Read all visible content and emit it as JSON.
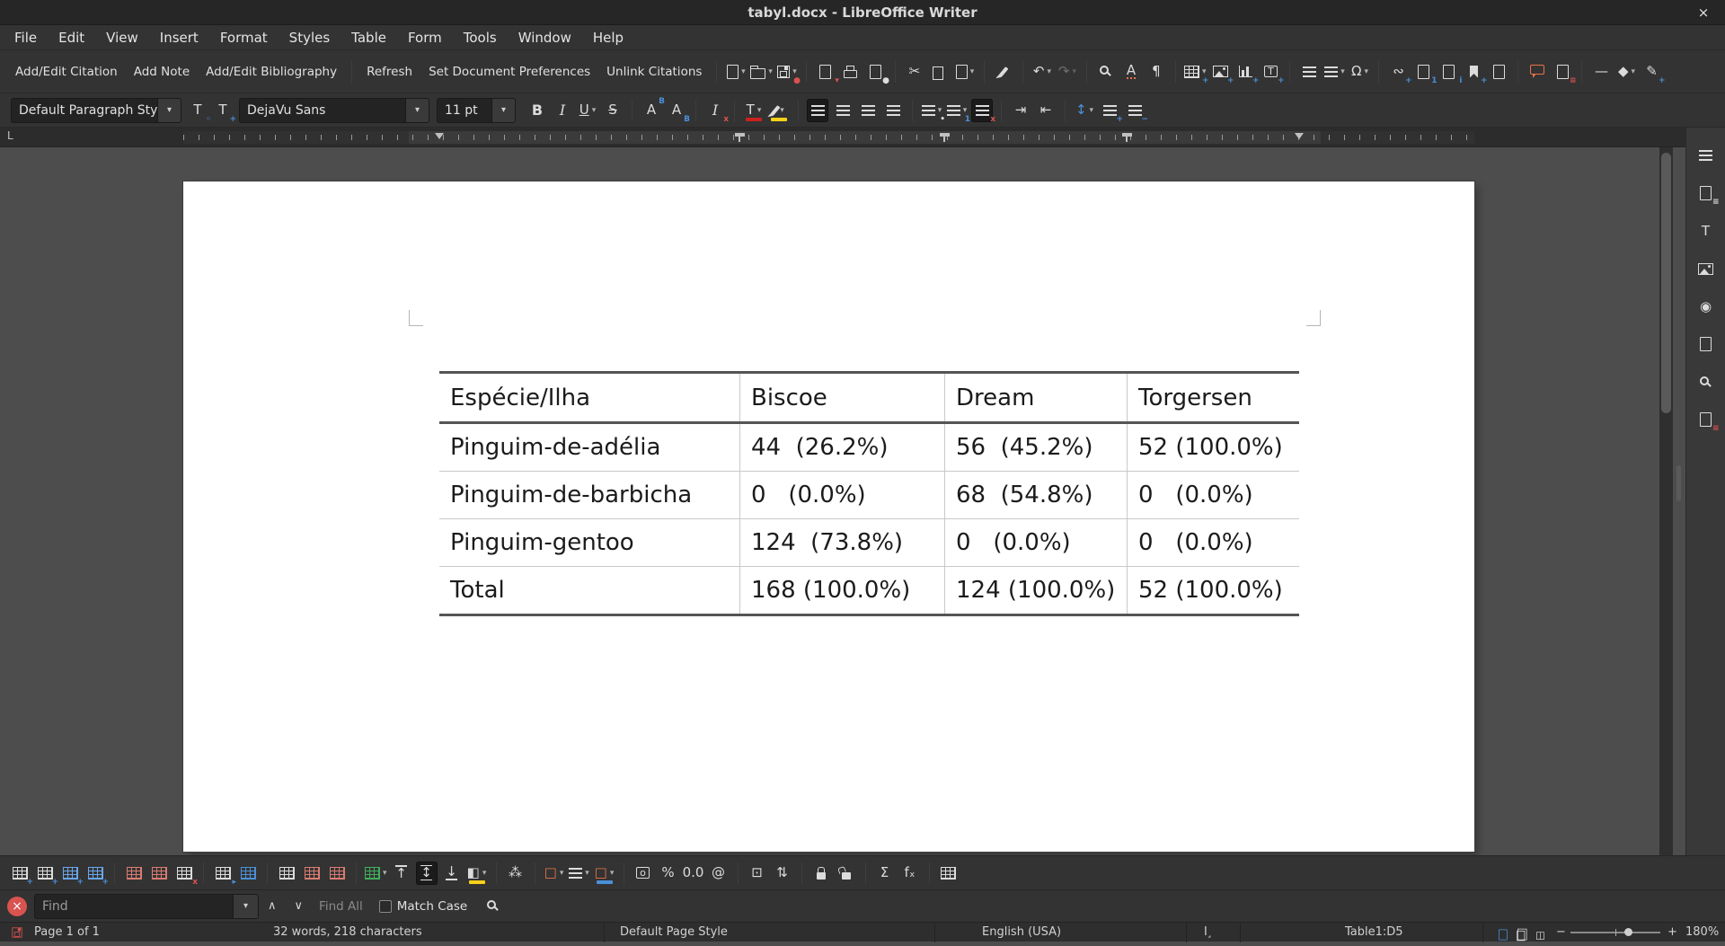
{
  "window": {
    "title": "tabyl.docx - LibreOffice Writer",
    "close_glyph": "×"
  },
  "glyphs": {
    "caret": "▾",
    "minus": "−",
    "plus": "+",
    "tabstop": "L"
  },
  "menubar": {
    "items": [
      "File",
      "Edit",
      "View",
      "Insert",
      "Format",
      "Styles",
      "Table",
      "Form",
      "Tools",
      "Window",
      "Help"
    ]
  },
  "zotero": {
    "buttons": [
      "Add/Edit Citation",
      "Add Note",
      "Add/Edit Bibliography",
      "Refresh",
      "Set Document Preferences",
      "Unlink Citations"
    ]
  },
  "main_toolbar": {
    "icons": [
      {
        "name": "new-document",
        "shape": "doc",
        "dd": 1
      },
      {
        "name": "open",
        "shape": "folder",
        "dd": 1
      },
      {
        "name": "save",
        "shape": "save",
        "badge": "●",
        "badgeColor": "#d9534f",
        "dd": 1
      },
      {
        "sep": 1
      },
      {
        "name": "export-pdf",
        "shape": "doc",
        "badge": "▾",
        "badgeColor": "#d9534f"
      },
      {
        "name": "print",
        "shape": "print"
      },
      {
        "name": "print-preview",
        "shape": "doc",
        "badge": "●",
        "badgeColor": "#dcdcdc"
      },
      {
        "sep": 1
      },
      {
        "name": "cut",
        "glyph": "✂"
      },
      {
        "name": "copy",
        "shape": "copy"
      },
      {
        "name": "paste",
        "shape": "doc",
        "dd": 1
      },
      {
        "sep": 1
      },
      {
        "name": "clone-formatting",
        "shape": "brush"
      },
      {
        "sep": 1
      },
      {
        "name": "undo",
        "glyph": "↶",
        "dd": 1
      },
      {
        "name": "redo",
        "glyph": "↷",
        "dd": 1,
        "disabled": 1
      },
      {
        "sep": 1
      },
      {
        "name": "find-replace",
        "shape": "mag"
      },
      {
        "name": "auto-spellcheck",
        "glyph": "A",
        "cls": "spell"
      },
      {
        "name": "formatting-marks",
        "glyph": "¶"
      },
      {
        "sep": 1
      },
      {
        "name": "insert-table",
        "shape": "grid",
        "badge": "+",
        "badgeColor": "#4a90d9",
        "dd": 1
      },
      {
        "name": "insert-image",
        "shape": "img",
        "badge": "+",
        "badgeColor": "#4a90d9"
      },
      {
        "name": "insert-chart",
        "shape": "chart",
        "badge": "+",
        "badgeColor": "#4a90d9"
      },
      {
        "name": "insert-textbox",
        "glyph": "T",
        "cls": "boxed",
        "badge": "+",
        "badgeColor": "#4a90d9"
      },
      {
        "sep": 1
      },
      {
        "name": "page-break",
        "shape": "lines"
      },
      {
        "name": "insert-field",
        "shape": "lines",
        "dd": 1
      },
      {
        "name": "special-character",
        "glyph": "Ω",
        "dd": 1
      },
      {
        "sep": 1
      },
      {
        "name": "insert-hyperlink",
        "glyph": "∾",
        "badge": "+",
        "badgeColor": "#4a90d9"
      },
      {
        "name": "insert-footnote",
        "shape": "doc",
        "badge": "1",
        "badgeColor": "#4a90d9"
      },
      {
        "name": "insert-endnote",
        "shape": "doc",
        "badge": "i",
        "badgeColor": "#4a90d9"
      },
      {
        "name": "insert-bookmark",
        "shape": "bkm",
        "badge": "+",
        "badgeColor": "#4a90d9"
      },
      {
        "name": "insert-cross-reference",
        "shape": "doc"
      },
      {
        "sep": 1
      },
      {
        "name": "insert-comment",
        "shape": "comment"
      },
      {
        "name": "track-changes",
        "shape": "doc",
        "badge": "≡",
        "badgeColor": "#d9534f"
      },
      {
        "sep": 1
      },
      {
        "name": "horizontal-line",
        "glyph": "—"
      },
      {
        "name": "basic-shapes",
        "glyph": "◆",
        "dd": 1
      },
      {
        "name": "show-draw-functions",
        "glyph": "✎",
        "badge": "+",
        "badgeColor": "#4a90d9"
      }
    ]
  },
  "formatting_toolbar": {
    "style_combo": "Default Paragraph Style",
    "font_combo": "DejaVu Sans",
    "size_combo": "11 pt",
    "style_actions": [
      {
        "name": "update-style",
        "glyph": "T",
        "badge": "◦",
        "badgeColor": "#4a90d9"
      },
      {
        "name": "new-style",
        "glyph": "T",
        "badge": "+",
        "badgeColor": "#4a90d9"
      }
    ],
    "icons": [
      {
        "name": "bold",
        "glyph": "B",
        "cls": "fb"
      },
      {
        "name": "italic",
        "glyph": "I",
        "cls": "fi"
      },
      {
        "name": "underline",
        "glyph": "U",
        "cls": "fu",
        "dd": 1
      },
      {
        "name": "strikethrough",
        "glyph": "S",
        "cls": "fs"
      },
      {
        "sep": 1
      },
      {
        "name": "superscript",
        "glyph": "A",
        "badge": "B",
        "badgePos": "tr",
        "badgeColor": "#4a90d9"
      },
      {
        "name": "subscript",
        "glyph": "A",
        "badge": "B",
        "badgePos": "br",
        "badgeColor": "#4a90d9"
      },
      {
        "sep": 1
      },
      {
        "name": "clear-formatting",
        "glyph": "I",
        "cls": "fi",
        "badge": "x",
        "badgeColor": "#d9534f"
      },
      {
        "sep": 1
      },
      {
        "name": "font-color",
        "glyph": "T",
        "bar": "#c9211e",
        "dd": 1
      },
      {
        "name": "highlight-color",
        "shape": "brush",
        "bar": "#f7d117",
        "dd": 1
      },
      {
        "sep": 1
      },
      {
        "name": "align-left",
        "shape": "lines",
        "active": 1
      },
      {
        "name": "align-center",
        "shape": "lines"
      },
      {
        "name": "align-right",
        "shape": "lines"
      },
      {
        "name": "justified",
        "shape": "lines"
      },
      {
        "sep": 1
      },
      {
        "name": "unordered-list",
        "shape": "lines",
        "badge": "•",
        "badgeColor": "#dcdcdc",
        "dd": 1
      },
      {
        "name": "ordered-list",
        "shape": "lines",
        "badge": "1",
        "badgeColor": "#4a90d9",
        "dd": 1
      },
      {
        "name": "no-list",
        "shape": "lines",
        "badge": "x",
        "badgeColor": "#d9534f",
        "active": 1
      },
      {
        "sep": 1
      },
      {
        "name": "increase-indent",
        "glyph": "⇥"
      },
      {
        "name": "decrease-indent",
        "glyph": "⇤"
      },
      {
        "sep": 1
      },
      {
        "name": "line-spacing",
        "glyph": "↕",
        "cls": "t-blue2",
        "dd": 1
      },
      {
        "name": "increase-paragraph-spacing",
        "shape": "lines",
        "badge": "+",
        "badgeColor": "#4a90d9"
      },
      {
        "name": "decrease-paragraph-spacing",
        "shape": "lines",
        "badge": "−",
        "badgeColor": "#4a90d9"
      }
    ]
  },
  "document": {
    "table": {
      "rows": [
        [
          "Espécie/Ilha",
          "Biscoe",
          "Dream",
          "Torgersen"
        ],
        [
          "Pinguim-de-adélia",
          "44  (26.2%)",
          "56  (45.2%)",
          "52 (100.0%)"
        ],
        [
          "Pinguim-de-barbicha",
          "0   (0.0%)",
          "68  (54.8%)",
          "0   (0.0%)"
        ],
        [
          "Pinguim-gentoo",
          "124  (73.8%)",
          "0   (0.0%)",
          "0   (0.0%)"
        ],
        [
          "Total",
          "168 (100.0%)",
          "124 (100.0%)",
          "52 (100.0%)"
        ]
      ]
    }
  },
  "sidebar": {
    "icons": [
      {
        "name": "sidebar-settings",
        "shape": "lines"
      },
      {
        "name": "properties",
        "shape": "doc",
        "badge": "≡",
        "badgeColor": "#dcdcdc"
      },
      {
        "name": "styles",
        "glyph": "T"
      },
      {
        "name": "gallery",
        "shape": "img"
      },
      {
        "name": "navigator",
        "glyph": "◉"
      },
      {
        "name": "page",
        "shape": "doc"
      },
      {
        "name": "style-inspector",
        "shape": "mag"
      },
      {
        "name": "manage-changes",
        "shape": "doc",
        "badge": "≡",
        "badgeColor": "#d9534f"
      }
    ]
  },
  "table_toolbar": {
    "icons": [
      {
        "name": "insert-row-above",
        "shape": "grid",
        "badge": "+",
        "badgeColor": "#4a90d9"
      },
      {
        "name": "insert-row-below",
        "shape": "grid",
        "badge": "+",
        "badgeColor": "#4a90d9"
      },
      {
        "name": "insert-column-before",
        "shape": "grid",
        "tint": "blue",
        "badge": "+",
        "badgeColor": "#4a90d9"
      },
      {
        "name": "insert-column-after",
        "shape": "grid",
        "tint": "blue",
        "badge": "+",
        "badgeColor": "#4a90d9"
      },
      {
        "sep": 1
      },
      {
        "name": "delete-row",
        "shape": "grid",
        "tint": "red"
      },
      {
        "name": "delete-column",
        "shape": "grid",
        "tint": "red"
      },
      {
        "name": "delete-table",
        "shape": "grid",
        "badge": "x",
        "badgeColor": "#d9534f"
      },
      {
        "sep": 1
      },
      {
        "name": "select-cell",
        "shape": "grid",
        "badge": "▸",
        "badgeColor": "#4a90d9"
      },
      {
        "name": "select-table",
        "shape": "grid",
        "tint": "blue2"
      },
      {
        "sep": 1
      },
      {
        "name": "merge-cells",
        "shape": "grid"
      },
      {
        "name": "split-cells",
        "shape": "grid",
        "tint": "red"
      },
      {
        "name": "split-table",
        "shape": "grid",
        "tint": "red"
      },
      {
        "sep": 1
      },
      {
        "name": "table-styles",
        "shape": "grid",
        "tint": "green",
        "dd": 1
      },
      {
        "name": "align-top",
        "glyph": "↑",
        "cls": "bar-top"
      },
      {
        "name": "center-vertically",
        "glyph": "↕",
        "cls": "bar-both",
        "active": 1
      },
      {
        "name": "align-bottom",
        "glyph": "↓",
        "cls": "bar-bottom"
      },
      {
        "name": "background-color",
        "glyph": "◧",
        "bar": "#f7d117",
        "dd": 1
      },
      {
        "sep": 1
      },
      {
        "name": "autoformat",
        "glyph": "⁂"
      },
      {
        "sep": 1
      },
      {
        "name": "borders",
        "glyph": "□",
        "cls": "torange",
        "dd": 1
      },
      {
        "name": "border-style",
        "shape": "lines",
        "dd": 1
      },
      {
        "name": "border-color",
        "glyph": "□",
        "cls": "torange",
        "bar": "#4a90d9",
        "dd": 1
      },
      {
        "sep": 1
      },
      {
        "name": "number-format",
        "glyph": "o",
        "cls": "boxed"
      },
      {
        "name": "number-format-percent",
        "glyph": "%"
      },
      {
        "name": "number-format-decimal",
        "glyph": "0.0"
      },
      {
        "name": "number-format-text",
        "glyph": "@"
      },
      {
        "sep": 1
      },
      {
        "name": "insert-caption",
        "glyph": "⊡"
      },
      {
        "name": "sort",
        "glyph": "⇅"
      },
      {
        "sep": 1
      },
      {
        "name": "protect-cells",
        "shape": "lock"
      },
      {
        "name": "unprotect-cells",
        "shape": "lock-open"
      },
      {
        "sep": 1
      },
      {
        "name": "sum",
        "glyph": "Σ"
      },
      {
        "name": "formula",
        "glyph": "fₓ"
      },
      {
        "sep": 1
      },
      {
        "name": "table-properties",
        "shape": "grid"
      }
    ]
  },
  "find_toolbar": {
    "close_glyph": "×",
    "placeholder": "Find",
    "prev_glyph": "∧",
    "next_glyph": "∨",
    "find_all_label": "Find All",
    "match_case_label": "Match Case"
  },
  "statusbar": {
    "page": "Page 1 of 1",
    "word_count": "32 words, 218 characters",
    "page_style": "Default Page Style",
    "language": "English (USA)",
    "insert_mode_glyph": "I˼",
    "table_cell": "Table1:D5",
    "zoom_level": "180%",
    "view_icons": [
      {
        "name": "single-page-view",
        "shape": "doc",
        "tint": "blue2"
      },
      {
        "name": "multiple-page-view",
        "shape": "copy"
      },
      {
        "name": "book-view",
        "glyph": "◫"
      }
    ]
  },
  "colors": {
    "accent_blue": "#4a90d9",
    "status_red": "#d9534f",
    "comment_orange": "#e8734a",
    "highlight_yellow": "#f7d117",
    "table_styles_green": "#3fae5a",
    "font_color_red": "#c9211e"
  }
}
